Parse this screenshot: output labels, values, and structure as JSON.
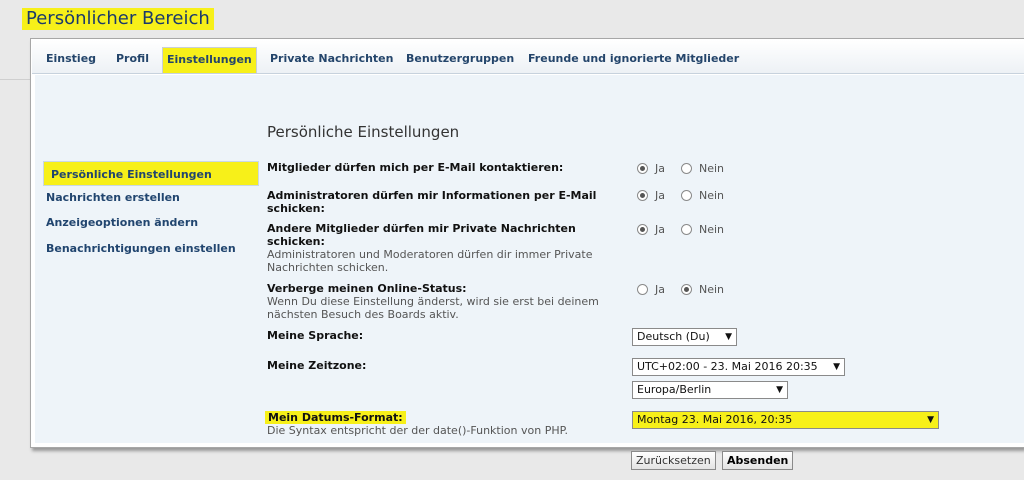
{
  "page_title": "Persönlicher Bereich",
  "tabs": [
    {
      "label": "Einstieg"
    },
    {
      "label": "Profil"
    },
    {
      "label": "Einstellungen",
      "active": true
    },
    {
      "label": "Private Nachrichten"
    },
    {
      "label": "Benutzergruppen"
    },
    {
      "label": "Freunde und ignorierte Mitglieder"
    }
  ],
  "sidebar": {
    "items": [
      {
        "label": "Persönliche Einstellungen",
        "active": true
      },
      {
        "label": "Nachrichten erstellen"
      },
      {
        "label": "Anzeigeoptionen ändern"
      },
      {
        "label": "Benachrichtigungen einstellen"
      }
    ]
  },
  "form": {
    "heading": "Persönliche Einstellungen",
    "rows": [
      {
        "label": "Mitglieder dürfen mich per E-Mail kontaktieren:",
        "hint": "",
        "selected": "Ja"
      },
      {
        "label_lines": [
          "Administratoren dürfen mir Informationen per E-Mail",
          "schicken:"
        ],
        "hint": "",
        "selected": "Ja"
      },
      {
        "label_lines": [
          "Andere Mitglieder dürfen mir Private Nachrichten",
          "schicken:"
        ],
        "hint_lines": [
          "Administratoren und Moderatoren dürfen dir immer Private",
          "Nachrichten schicken."
        ],
        "selected": "Ja"
      },
      {
        "label": "Verberge meinen Online-Status:",
        "hint_lines": [
          "Wenn Du diese Einstellung änderst, wird sie erst bei deinem",
          "nächsten Besuch des Boards aktiv."
        ],
        "selected": "Nein"
      }
    ],
    "radio_yes": "Ja",
    "radio_no": "Nein",
    "language": {
      "label": "Meine Sprache:",
      "value": "Deutsch (Du)"
    },
    "timezone": {
      "label": "Meine Zeitzone:",
      "value": "UTC+02:00 - 23. Mai 2016 20:35",
      "region": "Europa/Berlin"
    },
    "dateformat": {
      "label": "Mein Datums-Format:",
      "hint": "Die Syntax entspricht der der date()-Funktion von PHP.",
      "value": "Montag 23. Mai 2016, 20:35"
    },
    "reset_label": "Zurücksetzen",
    "submit_label": "Absenden"
  },
  "icons": {
    "dropdown": "chevron-down-icon"
  },
  "colors": {
    "highlight": "#f7f019",
    "link": "#21456f",
    "panel_bg": "#eef4f9"
  }
}
